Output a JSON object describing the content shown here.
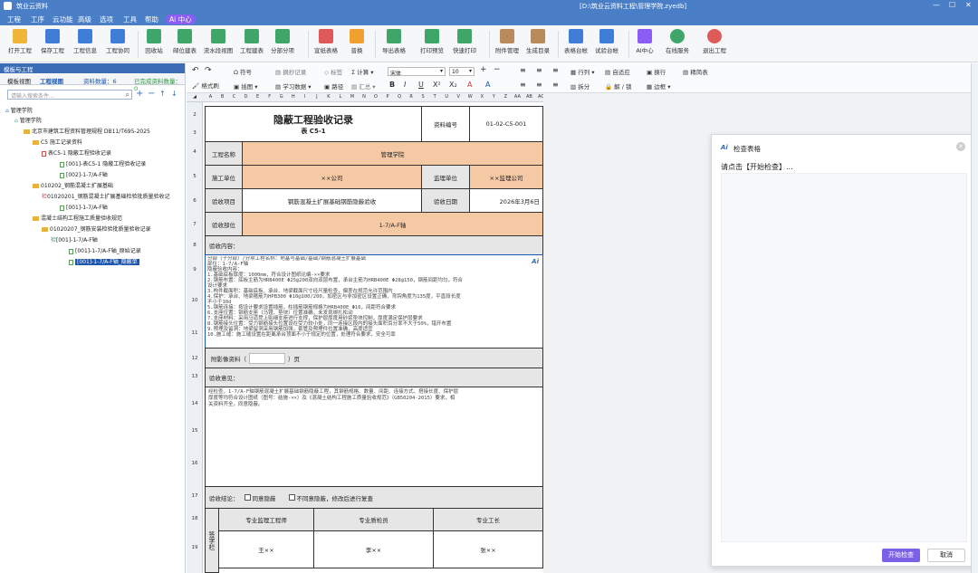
{
  "app": {
    "title": "筑业云资料",
    "path": "[D:\\筑业云资料工程\\管理学院.zyedb]"
  },
  "menu": [
    "工程",
    "工序",
    "云功能",
    "高级",
    "选项",
    "工具",
    "帮助"
  ],
  "menu_ai": "Ai 中心",
  "ribbon": [
    "打开工程",
    "保存工程",
    "工程信息",
    "工程协同",
    "回收站",
    "邮位建表",
    "流水段视图",
    "工程建表",
    "分部分项",
    "宣纸表格",
    "普换",
    "导出表格",
    "打印预览",
    "快速打印",
    "附件管理",
    "生成目录",
    "表格台帐",
    "试验台帐",
    "AI中心",
    "在线服务",
    "退出工程"
  ],
  "left_panel": {
    "title": "模板与工程",
    "tab1": "模板视图",
    "tab2": "工程视图",
    "count_label": "资料数量：6",
    "done_label": "已完成资料数量：0",
    "search_placeholder": "请输入搜索条件...",
    "tree": [
      "管理学院",
      "管理学院",
      "北京市建筑工程资料管理规程 DB11/T695-2025",
      "C5 施工记录资料",
      "表C5-1 隐蔽工程验收记录",
      "[001]-表C5-1 隐蔽工程验收记录",
      "[002]-1-7/A-F轴",
      "010202_钢筋混凝土扩展基础",
      "01020201_钢筋混凝土扩展基础检验批质量验收记",
      "[001]-1-7/A-F轴",
      "混凝土结构工程施工质量验收规范",
      "01020207_钢筋安装检验批质量验收记录",
      "[001]-1-7/A-F轴",
      "[001]-1-7/A-F轴_原始记录",
      "[001]-1-7/A-F轴_隐蔽单"
    ]
  },
  "toolbar2": {
    "format_brush": "格式刷",
    "symbol": "符号",
    "insert": "插图",
    "excerpt": "摘抄记录",
    "learn": "学习数据",
    "mark": "标签",
    "path_item": "路径",
    "calc": "计算",
    "summary": "汇总",
    "font": "宋体",
    "size": "10",
    "row_col": "行列",
    "auto_fit": "自适应",
    "split": "拆分",
    "lock": "解 / 锁",
    "wrap": "换行",
    "border": "边框",
    "fine_table": "精简表"
  },
  "cols": [
    "A",
    "B",
    "C",
    "D",
    "E",
    "F",
    "G",
    "H",
    "I",
    "J",
    "K",
    "L",
    "M",
    "N",
    "O",
    "P",
    "Q",
    "R",
    "S",
    "T",
    "U",
    "V",
    "W",
    "X",
    "Y",
    "Z",
    "AA",
    "AB",
    "AC"
  ],
  "rows": [
    "2",
    "3",
    "4",
    "5",
    "6",
    "7",
    "8",
    "9",
    "10",
    "11",
    "12",
    "13",
    "14",
    "15",
    "16",
    "17",
    "18",
    "19"
  ],
  "form": {
    "title": "隐蔽工程验收记录",
    "subtitle": "表 C5-1",
    "no_label": "资料编号",
    "no_value": "01-02-C5-001",
    "project_label": "工程名称",
    "project_value": "管理学院",
    "builder_label": "施工单位",
    "builder_value": "××公司",
    "supervisor_label": "监理单位",
    "supervisor_value": "××监理公司",
    "item_label": "验收项目",
    "item_value": "钢筋混凝土扩展基础钢筋隐蔽验收",
    "date_label": "验收日期",
    "date_value": "2026年3月6日",
    "part_label": "验收部位",
    "part_value": "1-7/A-F轴",
    "content_label": "验收内容：",
    "content_lines": [
      "分部（子分部）/分项工程名称：地基与基础/基础/钢筋混凝土扩展基础",
      "部位：1-7/A-F轴",
      "隐蔽验收内容：",
      "1.基础底板厚度：1000mm，符合设计图纸论编-××要求",
      "2.钢筋布置：底板主筋为HRB400E Φ25@200双向双层布置，承台主筋为HRB400E Φ28@150，钢筋间距均匀，符合",
      "设计要求",
      "3.构件截面积：基础底板、承台、地梁截面尺寸经尺量检查，偏差在规范允许范围内",
      "4.保护：承台、地梁箍筋为HPB300 Φ10@100/200，加密区与非加密区设置正确，弯钩角度为135度，平直段长度",
      "不小于10d",
      "5.钢筋连接：按设计要求设置插筋，柱插筋钢筋规格为HRB400E Φ16，间距符合要求",
      "6.支座位置：钢筋支座（马镫、垫块）位置准确，未发现绑扎松动",
      "7.支座材料：采用马道凳上贴细支座进行支撑，保护层厚度用砂浆垫块控制，厚度满足保护层要求",
      "8.钢筋接头位置：受力钢筋接头位置设在受力较小处，同一连接区段内的接头面积百分率不大于50%，错开布置",
      "9.预埋及留洞：地梁留洞采用钢筋加强，套管及预埋件位置准确，高度适宜",
      "10.施工缝：施工缝设置在距离承台顶面不小于规定的位置，处理符合要求，安全可靠"
    ],
    "attach_label": "附影像资料（",
    "attach_unit": "）页",
    "opinion_label": "验收意见：",
    "opinion_lines": [
      "经检查，1-7/A-F轴钢筋混凝土扩展基础钢筋隐蔽工程，其钢筋规格、数量、间距、连接方式、搭接长度、保护层",
      "厚度等均符合设计图纸（图号：结施-××）及《混凝土结构工程施工质量验收规范》（GB50204-2015）要求，相",
      "关资料齐全，同意隐蔽。"
    ],
    "conclusion_label": "验收结论：",
    "agree": "同意隐蔽",
    "disagree": "不同意隐蔽，修改后进行复查",
    "sign_side": "签字栏",
    "sign1": "专业监理工程师",
    "sign2": "专业质检员",
    "sign3": "专业工长",
    "name1": "王××",
    "name2": "李××",
    "name3": "张××"
  },
  "dialog": {
    "title": "检查表格",
    "prompt": "请点击【开始检查】...",
    "start": "开始检查",
    "cancel": "取消"
  },
  "colors": {
    "titlebar": "#4a7fc8",
    "orange": "#f6c9a5",
    "accent": "#8b5cf6"
  }
}
